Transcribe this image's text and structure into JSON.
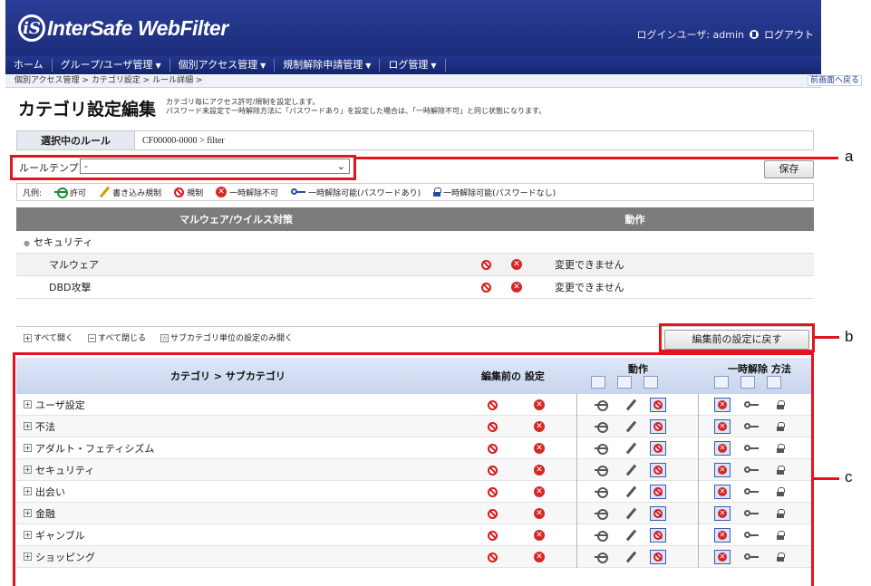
{
  "header": {
    "logo_text": "InterSafe WebFilter",
    "login_user": "ログインユーザ: admin",
    "logout": "ログアウト"
  },
  "menu": [
    {
      "label": "ホーム",
      "caret": ""
    },
    {
      "label": "グループ/ユーザ管理",
      "caret": "▼"
    },
    {
      "label": "個別アクセス管理",
      "caret": "▼"
    },
    {
      "label": "規制解除申請管理",
      "caret": "▼"
    },
    {
      "label": "ログ管理",
      "caret": "▼"
    }
  ],
  "breadcrumb": "個別アクセス管理 > カテゴリ設定 > ルール詳細 >",
  "back_link": "前画面へ戻る",
  "page": {
    "title": "カテゴリ設定編集",
    "desc_line1": "カテゴリ毎にアクセス許可/規制を設定します。",
    "desc_line2": "パスワード未設定で一時解除方法に「パスワードあり」を設定した場合は、「一時解除不可」と同じ状態になります。"
  },
  "selected_rule": {
    "label": "選択中のルール",
    "value": "CF00000-0000 > filter"
  },
  "template": {
    "label": "ルールテンプレート:",
    "value": "-"
  },
  "save_button": "保存",
  "legend": {
    "title": "凡例:",
    "allow": "許可",
    "write_block": "書き込み規制",
    "block": "規制",
    "no_unlock": "一時解除不可",
    "unlock_pw": "一時解除可能(パスワードあり)",
    "unlock_nopw": "一時解除可能(パスワードなし)"
  },
  "malware": {
    "header_name": "マルウェア/ウイルス対策",
    "header_action": "動作",
    "group": "セキュリティ",
    "rows": [
      {
        "name": "マルウェア",
        "status": "変更できません"
      },
      {
        "name": "DBD攻撃",
        "status": "変更できません"
      }
    ]
  },
  "expand_links": {
    "open_all": "すべて開く",
    "close_all": "すべて閉じる",
    "open_sub": "サブカテゴリ単位の設定のみ開く"
  },
  "reset_button": "編集前の設定に戻す",
  "category_table": {
    "col_category": "カテゴリ > サブカテゴリ",
    "col_before": "編集前の 設定",
    "col_action": "動作",
    "col_unlock": "一時解除 方法",
    "rows": [
      "ユーザ設定",
      "不法",
      "アダルト・フェティシズム",
      "セキュリティ",
      "出会い",
      "金融",
      "ギャンブル",
      "ショッピング"
    ]
  },
  "annotations": [
    "a",
    "b",
    "c"
  ],
  "colors": {
    "header": "#1c2d7c",
    "annotation_red": "#e4141e",
    "block_red": "#d81b1b",
    "allow_blue": "#1a66c2"
  }
}
